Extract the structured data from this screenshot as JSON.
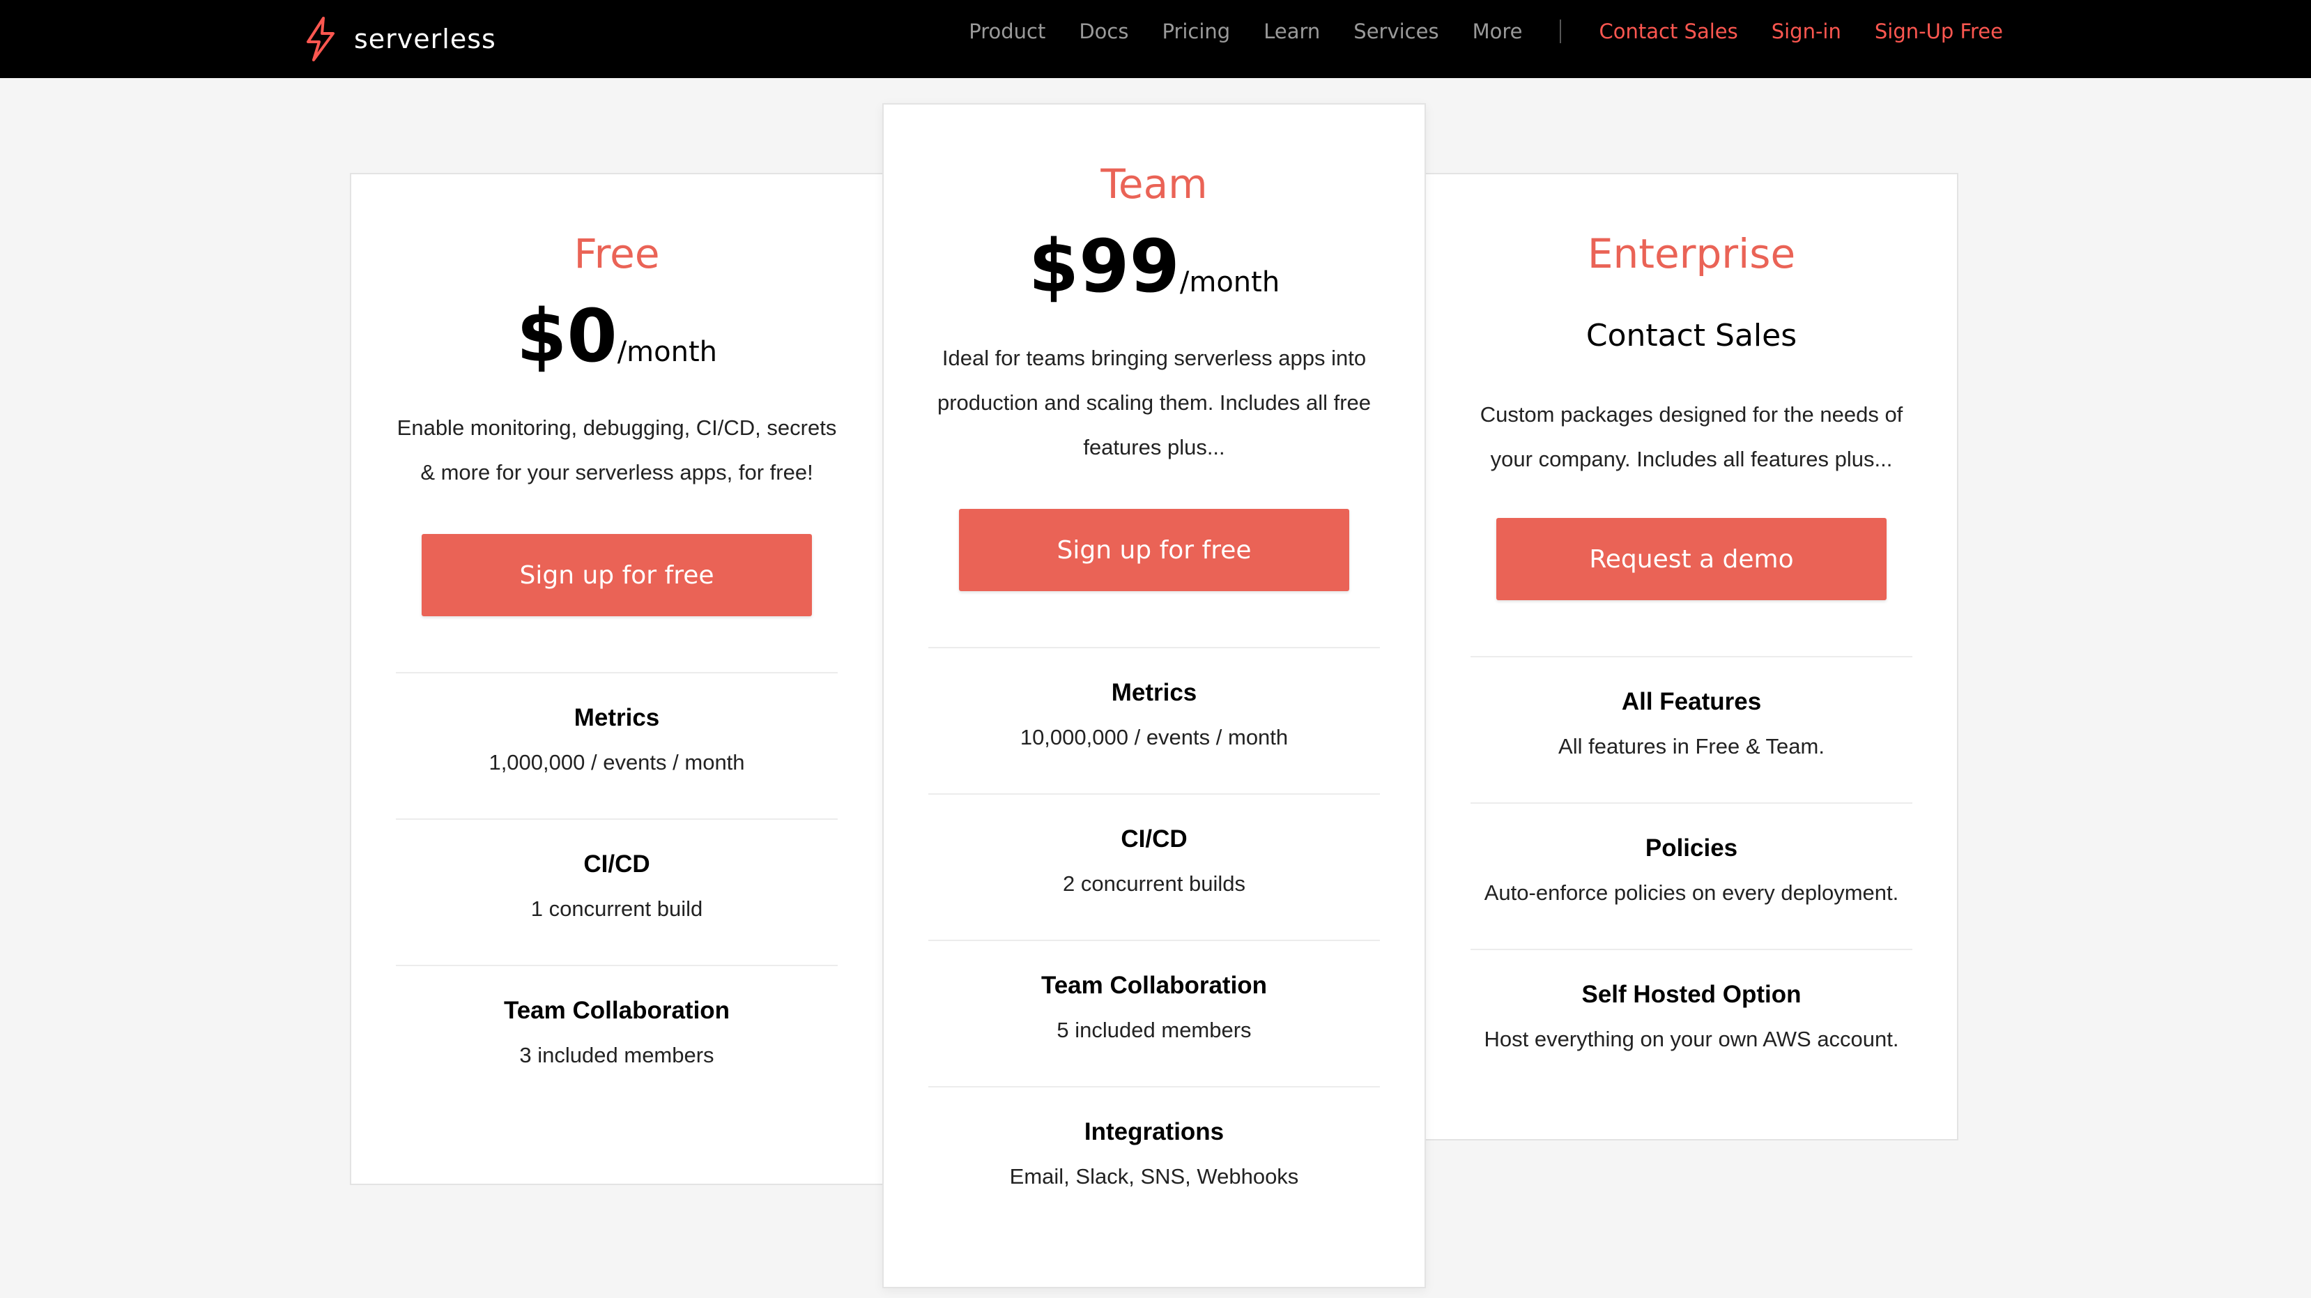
{
  "header": {
    "brand": "serverless",
    "accent_color": "#fd5750",
    "nav": [
      "Product",
      "Docs",
      "Pricing",
      "Learn",
      "Services",
      "More"
    ],
    "actions": [
      "Contact Sales",
      "Sign-in",
      "Sign-Up Free"
    ]
  },
  "plans": {
    "free": {
      "tier": "Free",
      "price": "$0",
      "period": "/month",
      "description": "Enable monitoring, debugging, CI/CD, secrets & more for your serverless apps, for free!",
      "cta": "Sign up for free",
      "features": [
        {
          "title": "Metrics",
          "detail": "1,000,000 / events / month"
        },
        {
          "title": "CI/CD",
          "detail": "1 concurrent build"
        },
        {
          "title": "Team Collaboration",
          "detail": "3 included members"
        }
      ]
    },
    "team": {
      "tier": "Team",
      "price": "$99",
      "period": "/month",
      "description": "Ideal for teams bringing serverless apps into production and scaling them. Includes all free features plus...",
      "cta": "Sign up for free",
      "features": [
        {
          "title": "Metrics",
          "detail": "10,000,000 / events / month"
        },
        {
          "title": "CI/CD",
          "detail": "2 concurrent builds"
        },
        {
          "title": "Team Collaboration",
          "detail": "5 included members"
        },
        {
          "title": "Integrations",
          "detail": "Email, Slack, SNS, Webhooks"
        }
      ]
    },
    "enterprise": {
      "tier": "Enterprise",
      "contact": "Contact Sales",
      "description": "Custom packages designed for the needs of your company. Includes all features plus...",
      "cta": "Request a demo",
      "features": [
        {
          "title": "All Features",
          "detail": "All features in Free & Team."
        },
        {
          "title": "Policies",
          "detail": "Auto-enforce policies on every deployment."
        },
        {
          "title": "Self Hosted Option",
          "detail": "Host everything on your own AWS account."
        }
      ]
    }
  }
}
